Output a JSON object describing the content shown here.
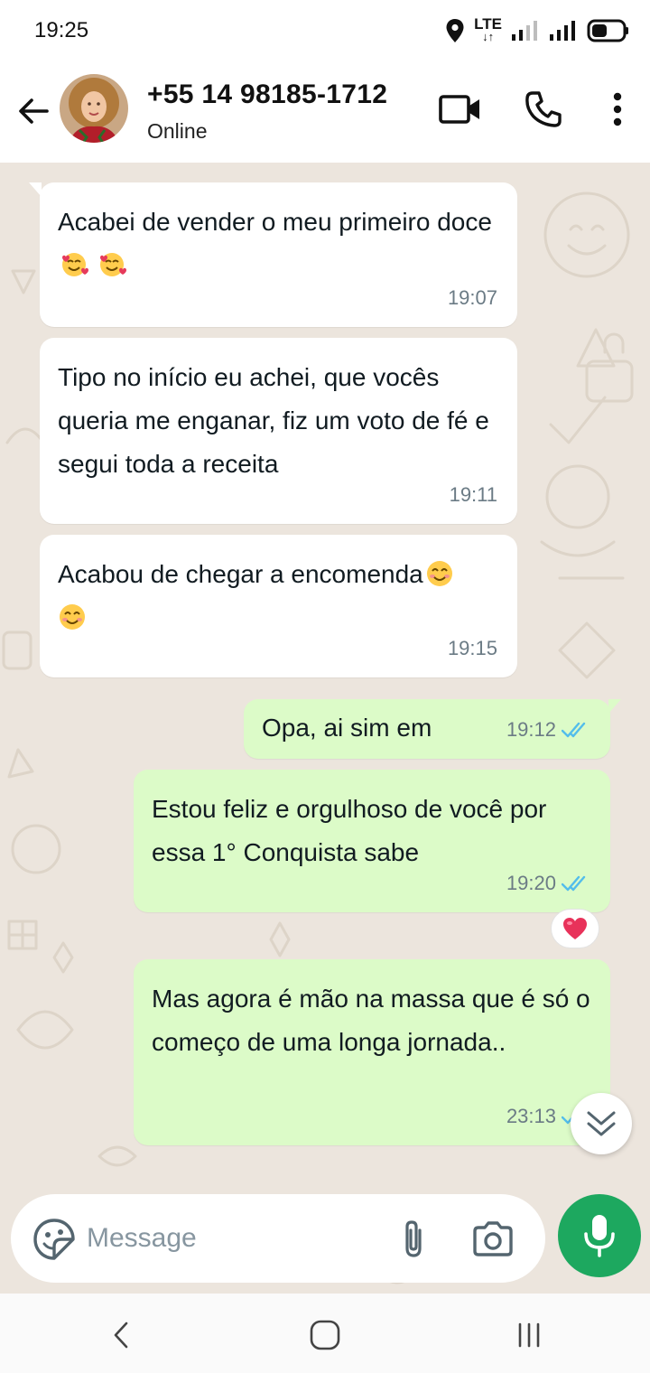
{
  "status_bar": {
    "time": "19:25",
    "network": "LTE"
  },
  "header": {
    "contact_name": "+55 14 98185-1712",
    "contact_status": "Online"
  },
  "messages": [
    {
      "direction": "in",
      "text": "Acabei de vender o meu primeiro doce",
      "emoji": [
        "smiling-face-with-hearts",
        "smiling-face-with-hearts"
      ],
      "time": "19:07"
    },
    {
      "direction": "in",
      "text": "Tipo no início eu achei, que vocês queria me enganar, fiz um voto de fé e segui toda a receita",
      "time": "19:11"
    },
    {
      "direction": "in",
      "text": "Acabou de chegar a encomenda",
      "emoji": [
        "smiling-face-with-smiling-eyes",
        "smiling-face-with-smiling-eyes"
      ],
      "time": "19:15"
    },
    {
      "direction": "out",
      "text": "Opa, ai sim em",
      "time": "19:12",
      "status": "read"
    },
    {
      "direction": "out",
      "text": "Estou feliz e orgulhoso de você por essa 1° Conquista sabe",
      "time": "19:20",
      "status": "read",
      "reaction": "heart"
    },
    {
      "direction": "out",
      "text": "Mas agora é mão na massa que é só o começo de uma longa jornada..",
      "time": "23:13",
      "status": "read"
    }
  ],
  "composer": {
    "placeholder": "Message"
  },
  "colors": {
    "chat_background": "#ece5dd",
    "incoming_bubble": "#ffffff",
    "outgoing_bubble": "#dcfbc8",
    "read_ticks": "#53bdeb",
    "mic_button": "#1da85f"
  },
  "icons": [
    "back-arrow-icon",
    "video-call-icon",
    "phone-icon",
    "more-options-icon",
    "sticker-icon",
    "attach-icon",
    "camera-icon",
    "mic-icon",
    "chevron-double-down-icon",
    "heart-icon"
  ]
}
